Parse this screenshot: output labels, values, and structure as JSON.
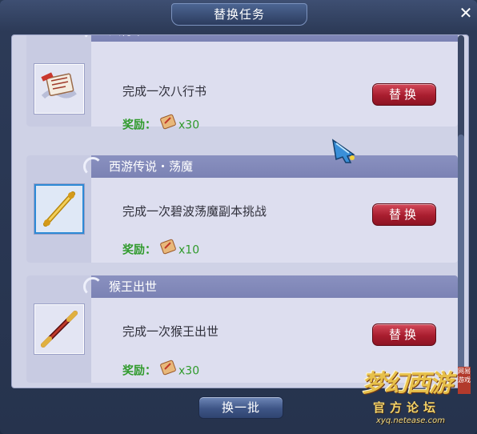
{
  "window": {
    "title": "替换任务",
    "close_symbol": "✕"
  },
  "tasks": [
    {
      "title": "八行书",
      "description": "完成一次八行书",
      "reward_label": "奖励：",
      "reward_count": "x30",
      "item_icon": "letter-scroll-icon",
      "swap_label": "替换"
    },
    {
      "title": "西游传说・荡魔",
      "description": "完成一次碧波荡魔副本挑战",
      "reward_label": "奖励：",
      "reward_count": "x10",
      "item_icon": "golden-staff-icon",
      "swap_label": "替换"
    },
    {
      "title": "猴王出世",
      "description": "完成一次猴王出世",
      "reward_label": "奖励：",
      "reward_count": "x30",
      "item_icon": "red-staff-icon",
      "swap_label": "替换"
    }
  ],
  "refresh_label": "换一批",
  "watermark": {
    "logo_text": "梦幻西游",
    "badge_text": "网易游戏",
    "subtitle": "官方论坛",
    "url": "xyq.netease.com"
  },
  "colors": {
    "reward_green": "#2f9a2b",
    "swap_red": "#a81d2e",
    "header_purple": "#7b82b4"
  }
}
